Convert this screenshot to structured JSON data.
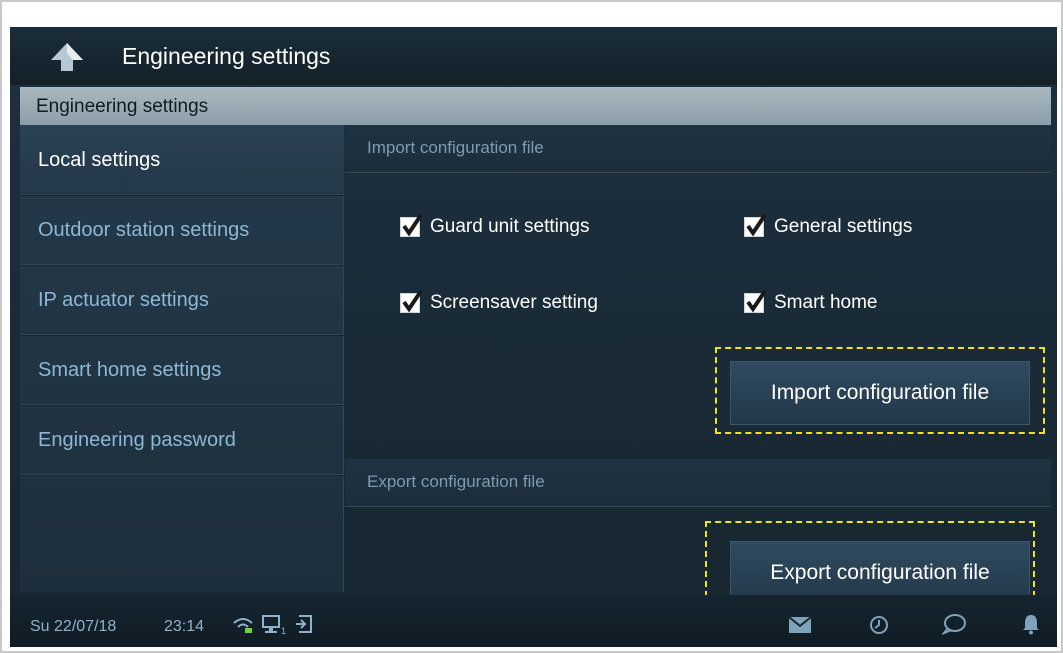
{
  "topbar": {
    "title": "Engineering settings",
    "back_icon": "back-arrow-icon"
  },
  "header": {
    "title": "Engineering settings"
  },
  "sidebar": {
    "items": [
      {
        "label": "Local settings",
        "active": true
      },
      {
        "label": "Outdoor station settings",
        "active": false
      },
      {
        "label": "IP actuator settings",
        "active": false
      },
      {
        "label": "Smart home settings",
        "active": false
      },
      {
        "label": "Engineering password",
        "active": false
      }
    ]
  },
  "import_section": {
    "title": "Import configuration file",
    "options": [
      {
        "label": "Guard unit settings",
        "checked": true
      },
      {
        "label": "General settings",
        "checked": true
      },
      {
        "label": "Screensaver setting",
        "checked": true
      },
      {
        "label": "Smart home",
        "checked": true
      }
    ],
    "button_label": "Import configuration file"
  },
  "export_section": {
    "title": "Export configuration file",
    "button_label": "Export configuration file"
  },
  "status": {
    "date": "Su 22/07/18",
    "time": "23:14",
    "network_badge": "1",
    "icons": [
      "wifi-icon",
      "network-icon",
      "door-icon",
      "mail-icon",
      "history-icon",
      "chat-icon",
      "bell-icon"
    ]
  },
  "colors": {
    "highlight_dash": "#f2e321",
    "accent_text": "#8db7d3"
  }
}
